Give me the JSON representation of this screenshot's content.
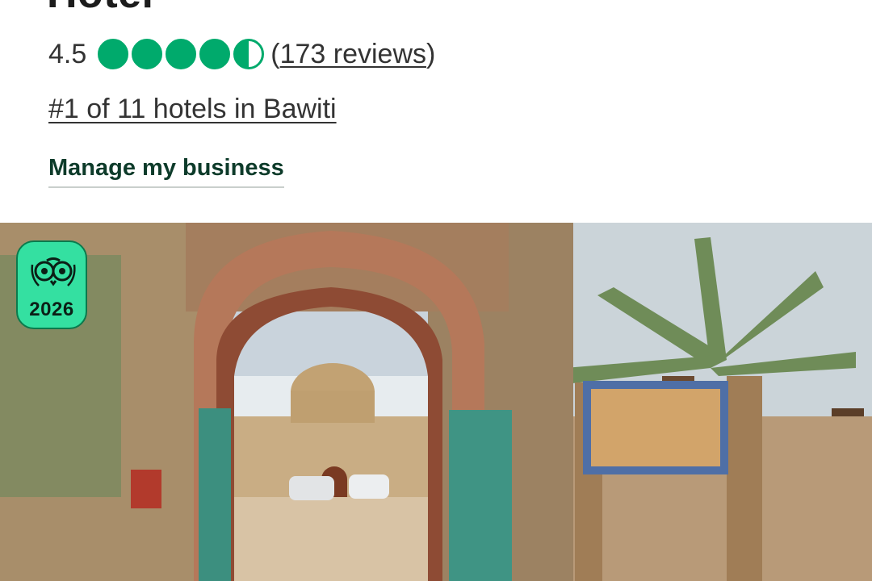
{
  "header": {
    "title_fragment": "Hotel"
  },
  "rating": {
    "score": "4.5",
    "bubbles_value": 4.5,
    "bubbles_max": 5,
    "open_paren": "(",
    "reviews_link": "173 reviews",
    "close_paren": ")"
  },
  "ranking_link": "#1 of 11 hotels in Bawiti",
  "manage_link": "Manage my business",
  "photo": {
    "award_badge": {
      "icon": "tripadvisor-owl-icon",
      "year": "2026",
      "color": "#34e0a1"
    }
  },
  "colors": {
    "bubble_green": "#00aa6c",
    "manage_text": "#0d3b2a"
  }
}
